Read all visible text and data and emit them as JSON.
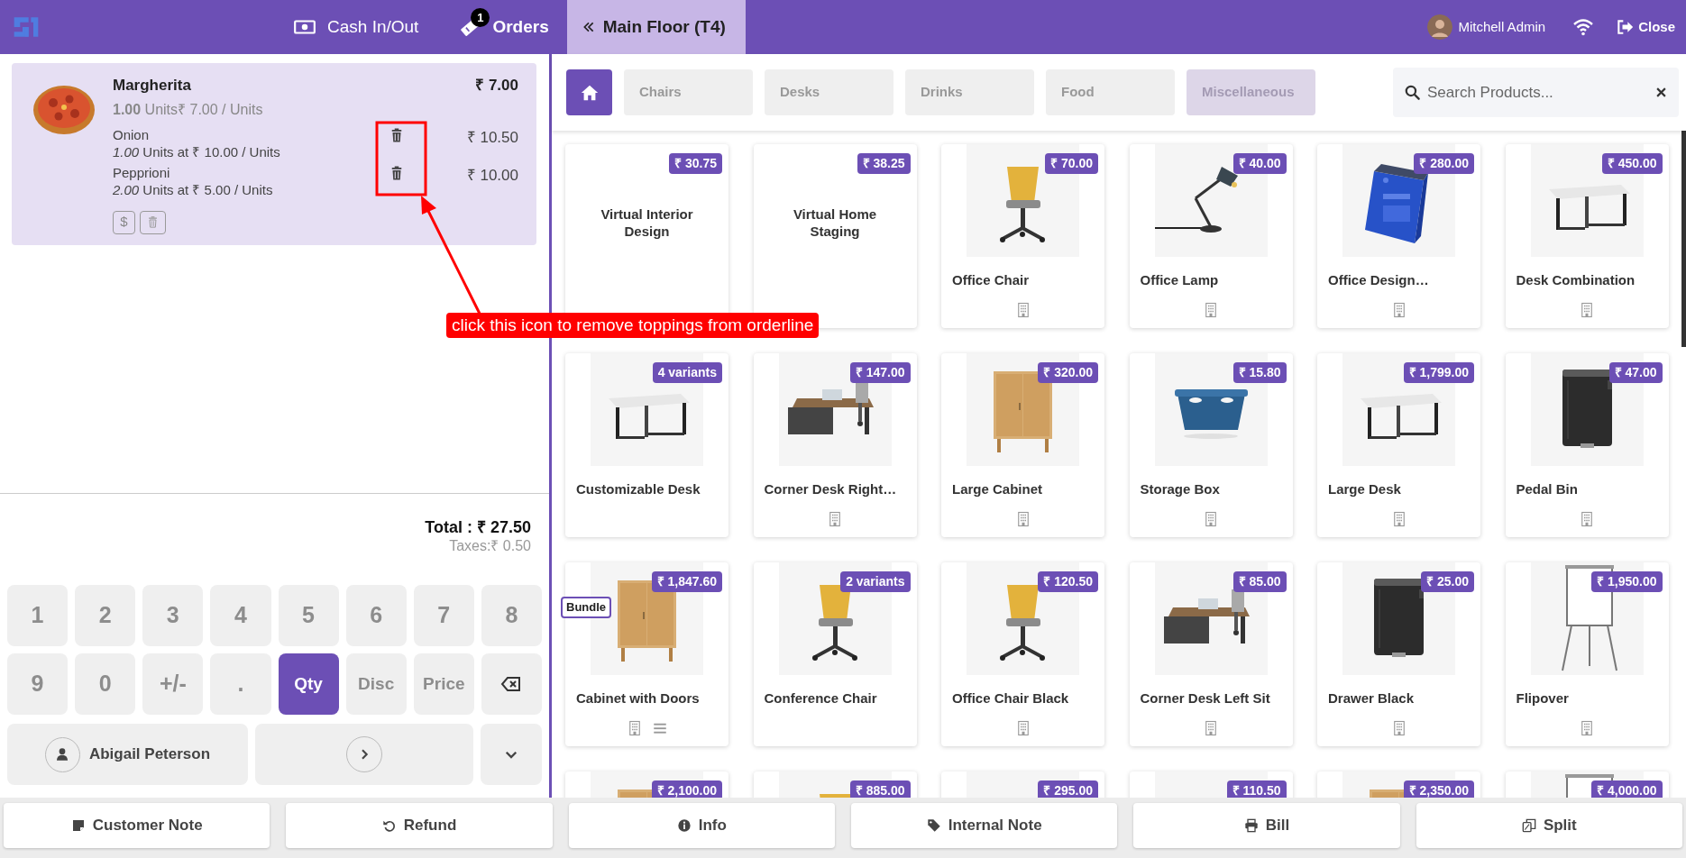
{
  "top_bar": {
    "menu": [
      {
        "kind": "cash",
        "label": "Cash In/Out"
      },
      {
        "kind": "orders",
        "label": "Orders",
        "badge": "1"
      }
    ],
    "floor_tab": {
      "label": "Main Floor (T4)"
    },
    "user": {
      "name": "Mitchell Admin"
    },
    "close": {
      "label": "Close"
    }
  },
  "order": {
    "lines": [
      {
        "name": "Margherita",
        "price": "₹ 7.00",
        "detail": "**1.00** Units₹ 7.00 / Units",
        "toppings": [
          {
            "name": "Onion",
            "detail": "*1.00* Units at ₹ 10.00 / Units",
            "price": "₹ 10.50"
          },
          {
            "name": "Pepprioni",
            "detail": "*2.00* Units at ₹ 5.00 / Units",
            "price": "₹ 10.00"
          }
        ],
        "actions": [
          {
            "kind": "price",
            "label": "$"
          },
          {
            "kind": "delete"
          }
        ]
      }
    ]
  },
  "annotation": {
    "text": "click this icon to remove toppings from orderline"
  },
  "totals": {
    "total": "Total : ₹ 27.50",
    "taxes": "Taxes:₹ 0.50"
  },
  "numpad": {
    "keys": [
      {
        "kind": "digit",
        "label": "1",
        "selected": false
      },
      {
        "kind": "digit",
        "label": "2",
        "selected": false
      },
      {
        "kind": "digit",
        "label": "3",
        "selected": false
      },
      {
        "kind": "digit",
        "label": "4",
        "selected": false
      },
      {
        "kind": "digit",
        "label": "5",
        "selected": false
      },
      {
        "kind": "digit",
        "label": "6",
        "selected": false
      },
      {
        "kind": "digit",
        "label": "7",
        "selected": false
      },
      {
        "kind": "digit",
        "label": "8",
        "selected": false
      },
      {
        "kind": "digit",
        "label": "9",
        "selected": false
      },
      {
        "kind": "digit",
        "label": "0",
        "selected": false
      },
      {
        "kind": "digit",
        "label": "+/-",
        "selected": false
      },
      {
        "kind": "digit",
        "label": ".",
        "selected": false
      },
      {
        "kind": "mode",
        "label": "Qty",
        "selected": true
      },
      {
        "kind": "mode",
        "label": "Disc",
        "selected": false
      },
      {
        "kind": "mode",
        "label": "Price",
        "selected": false
      },
      {
        "kind": "backspace",
        "selected": false
      }
    ],
    "customer": "Abigail Peterson"
  },
  "categories": [
    {
      "label": "Chairs",
      "selected": false
    },
    {
      "label": "Desks",
      "selected": false
    },
    {
      "label": "Drinks",
      "selected": false
    },
    {
      "label": "Food",
      "selected": false
    },
    {
      "label": "Miscellaneous",
      "selected": true
    }
  ],
  "search": {
    "placeholder": "Search Products..."
  },
  "products": [
    {
      "name": "Virtual Interior Design",
      "badge": "₹ 30.75",
      "kind": "service"
    },
    {
      "name": "Virtual Home Staging",
      "badge": "₹ 38.25",
      "kind": "service"
    },
    {
      "name": "Office Chair",
      "badge": "₹ 70.00",
      "kind": "picture",
      "icons": [
        {
          "kind": "info"
        }
      ]
    },
    {
      "name": "Office Lamp",
      "badge": "₹ 40.00",
      "kind": "picture",
      "icons": [
        {
          "kind": "info"
        }
      ]
    },
    {
      "name": "Office Design…",
      "badge": "₹ 280.00",
      "kind": "picture",
      "icons": [
        {
          "kind": "info"
        }
      ]
    },
    {
      "name": "Desk Combination",
      "badge": "₹ 450.00",
      "kind": "picture",
      "icons": [
        {
          "kind": "info"
        }
      ]
    },
    {
      "name": "Customizable Desk",
      "badge": "4 variants",
      "kind": "picture"
    },
    {
      "name": "Corner Desk Right…",
      "badge": "₹ 147.00",
      "kind": "picture",
      "icons": [
        {
          "kind": "info"
        }
      ]
    },
    {
      "name": "Large Cabinet",
      "badge": "₹ 320.00",
      "kind": "picture",
      "icons": [
        {
          "kind": "info"
        }
      ]
    },
    {
      "name": "Storage Box",
      "badge": "₹ 15.80",
      "kind": "picture",
      "icons": [
        {
          "kind": "info"
        }
      ]
    },
    {
      "name": "Large Desk",
      "badge": "₹ 1,799.00",
      "kind": "picture",
      "icons": [
        {
          "kind": "info"
        }
      ]
    },
    {
      "name": "Pedal Bin",
      "badge": "₹ 47.00",
      "kind": "picture",
      "icons": [
        {
          "kind": "info"
        }
      ]
    },
    {
      "name": "Cabinet with Doors",
      "badge": "₹ 1,847.60",
      "kind": "picture",
      "tag": "Bundle",
      "icons": [
        {
          "kind": "info"
        },
        {
          "kind": "list"
        }
      ]
    },
    {
      "name": "Conference Chair",
      "badge": "2 variants",
      "kind": "picture"
    },
    {
      "name": "Office Chair Black",
      "badge": "₹ 120.50",
      "kind": "picture",
      "icons": [
        {
          "kind": "info"
        }
      ]
    },
    {
      "name": "Corner Desk Left Sit",
      "badge": "₹ 85.00",
      "kind": "picture",
      "icons": [
        {
          "kind": "info"
        }
      ]
    },
    {
      "name": "Drawer Black",
      "badge": "₹ 25.00",
      "kind": "picture",
      "icons": [
        {
          "kind": "info"
        }
      ]
    },
    {
      "name": "Flipover",
      "badge": "₹ 1,950.00",
      "kind": "picture",
      "icons": [
        {
          "kind": "info"
        }
      ]
    },
    {
      "badge": "₹ 2,100.00",
      "kind": "picture"
    },
    {
      "badge": "₹ 885.00",
      "kind": "picture"
    },
    {
      "badge": "₹ 295.00",
      "kind": "picture"
    },
    {
      "badge": "₹ 110.50",
      "kind": "picture"
    },
    {
      "badge": "₹ 2,350.00",
      "kind": "picture"
    },
    {
      "badge": "₹ 4,000.00",
      "kind": "picture"
    }
  ],
  "bottom_bar": [
    {
      "kind": "note",
      "label": "Customer Note"
    },
    {
      "kind": "refund",
      "label": "Refund"
    },
    {
      "kind": "info",
      "label": "Info"
    },
    {
      "kind": "tag",
      "label": "Internal Note"
    },
    {
      "kind": "print",
      "label": "Bill"
    },
    {
      "kind": "split",
      "label": "Split"
    }
  ]
}
